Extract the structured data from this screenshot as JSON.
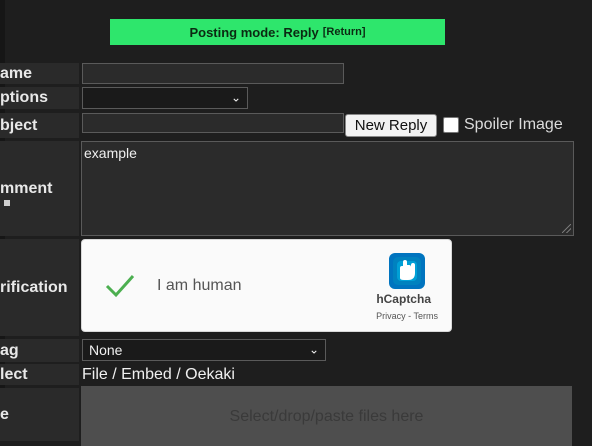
{
  "banner": {
    "text": "Posting mode: Reply",
    "return_link": "[Return]"
  },
  "labels": {
    "name": "ame",
    "options": "ptions",
    "subject": "bject",
    "comment": "mment",
    "verification": "rification",
    "flag": "ag",
    "select": "lect",
    "file": "e"
  },
  "fields": {
    "name_value": "",
    "options_value": "",
    "subject_value": "",
    "comment_value": "example"
  },
  "buttons": {
    "new_reply": "New Reply"
  },
  "spoiler": {
    "label": "Spoiler Image",
    "checked": false
  },
  "captcha": {
    "status_text": "I am human",
    "brand": "hCaptcha",
    "links": "Privacy - Terms"
  },
  "flag_select": {
    "selected": "None"
  },
  "select_modes": "File / Embed / Oekaki",
  "dropzone": {
    "text": "Select/drop/paste files here"
  },
  "colors": {
    "banner_bg": "#2ee66c",
    "page_bg": "#1e1e1e",
    "label_bg": "#2a2a2a",
    "captcha_check": "#4caf50",
    "hcaptcha_brand": "#0074bf"
  }
}
